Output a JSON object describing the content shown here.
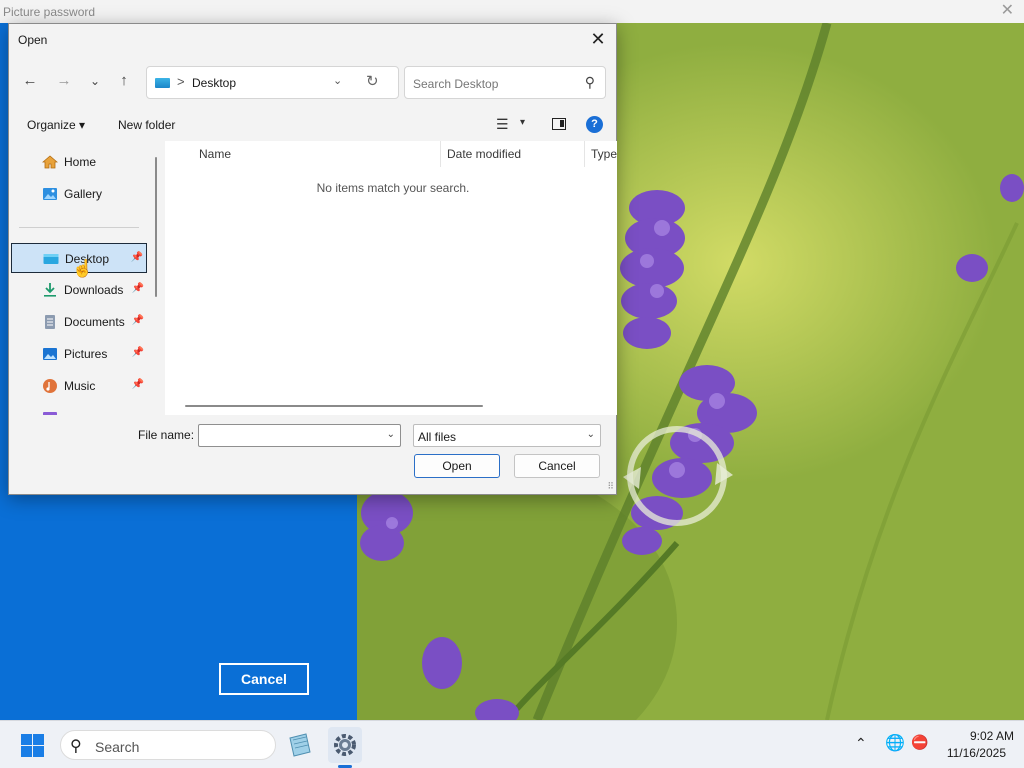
{
  "background_window": {
    "title": "Picture password",
    "close_glyph": "✕",
    "cancel_label": "Cancel"
  },
  "dialog": {
    "title": "Open",
    "close_glyph": "✕",
    "nav": {
      "back_glyph": "←",
      "forward_glyph": "→",
      "recent_glyph": "⌄",
      "up_glyph": "↑"
    },
    "address": {
      "separator": ">",
      "location": "Desktop",
      "dropdown_glyph": "⌄",
      "refresh_glyph": "↻"
    },
    "search": {
      "placeholder": "Search Desktop",
      "icon_glyph": "⚲"
    },
    "toolbar": {
      "organize_label": "Organize ▾",
      "new_folder_label": "New folder",
      "view_glyph": "☰",
      "view_dropdown_glyph": "▾",
      "help_glyph": "?"
    },
    "sidebar": {
      "items": [
        {
          "label": "Home",
          "icon": "home-icon",
          "pinned": false,
          "selected": false
        },
        {
          "label": "Gallery",
          "icon": "gallery-icon",
          "pinned": false,
          "selected": false
        },
        {
          "label": "Desktop",
          "icon": "desktop-icon",
          "pinned": true,
          "selected": true
        },
        {
          "label": "Downloads",
          "icon": "download-icon",
          "pinned": true,
          "selected": false
        },
        {
          "label": "Documents",
          "icon": "documents-icon",
          "pinned": true,
          "selected": false
        },
        {
          "label": "Pictures",
          "icon": "pictures-icon",
          "pinned": true,
          "selected": false
        },
        {
          "label": "Music",
          "icon": "music-icon",
          "pinned": true,
          "selected": false
        }
      ],
      "pin_glyph": "📌"
    },
    "columns": [
      "Name",
      "Date modified",
      "Type"
    ],
    "sort_glyph": "⌃",
    "empty_message": "No items match your search.",
    "file_name_label": "File name:",
    "file_name_value": "",
    "file_type_value": "All files",
    "open_label": "Open",
    "cancel_label": "Cancel",
    "dropdown_glyph": "⌄",
    "grip_glyph": "⠿"
  },
  "cursor_glyph": "☝",
  "taskbar": {
    "search_label": "Search",
    "search_icon_glyph": "⚲",
    "tray_chevron_glyph": "⌃",
    "tray_globe_glyph": "🌐",
    "tray_network_glyph": "⛔",
    "time": "9:02 AM",
    "date": "11/16/2025"
  },
  "colors": {
    "accent": "#1a6fd6",
    "picture_password_panel": "#0a6fd6",
    "selection": "#cde3f7"
  }
}
